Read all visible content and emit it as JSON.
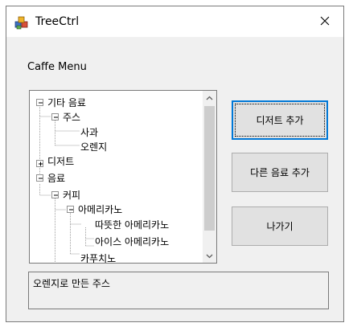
{
  "window": {
    "title": "TreeCtrl",
    "icon": "app-cubes-icon",
    "close_icon": "close-icon"
  },
  "caption": "Caffe Menu",
  "tree": {
    "items": [
      {
        "label": "기타 음료",
        "level": 0,
        "state": "expanded"
      },
      {
        "label": "주스",
        "level": 1,
        "state": "expanded"
      },
      {
        "label": "사과",
        "level": 2,
        "state": "leaf"
      },
      {
        "label": "오렌지",
        "level": 2,
        "state": "leaf"
      },
      {
        "label": "디저트",
        "level": 0,
        "state": "collapsed"
      },
      {
        "label": "음료",
        "level": 0,
        "state": "expanded"
      },
      {
        "label": "커피",
        "level": 1,
        "state": "expanded"
      },
      {
        "label": "아메리카노",
        "level": 2,
        "state": "expanded"
      },
      {
        "label": "따뜻한 아메리카노",
        "level": 3,
        "state": "leaf"
      },
      {
        "label": "아이스 아메리카노",
        "level": 3,
        "state": "leaf"
      },
      {
        "label": "카푸치노",
        "level": 2,
        "state": "leaf"
      }
    ]
  },
  "buttons": {
    "add_dessert": "디저트 추가",
    "add_other_drink": "다른 음료 추가",
    "exit": "나가기"
  },
  "status_text": "오렌지로 만든 주스",
  "colors": {
    "focus_border": "#0078d7",
    "button_face": "#e1e1e1",
    "window_bg": "#f0f0f0"
  }
}
